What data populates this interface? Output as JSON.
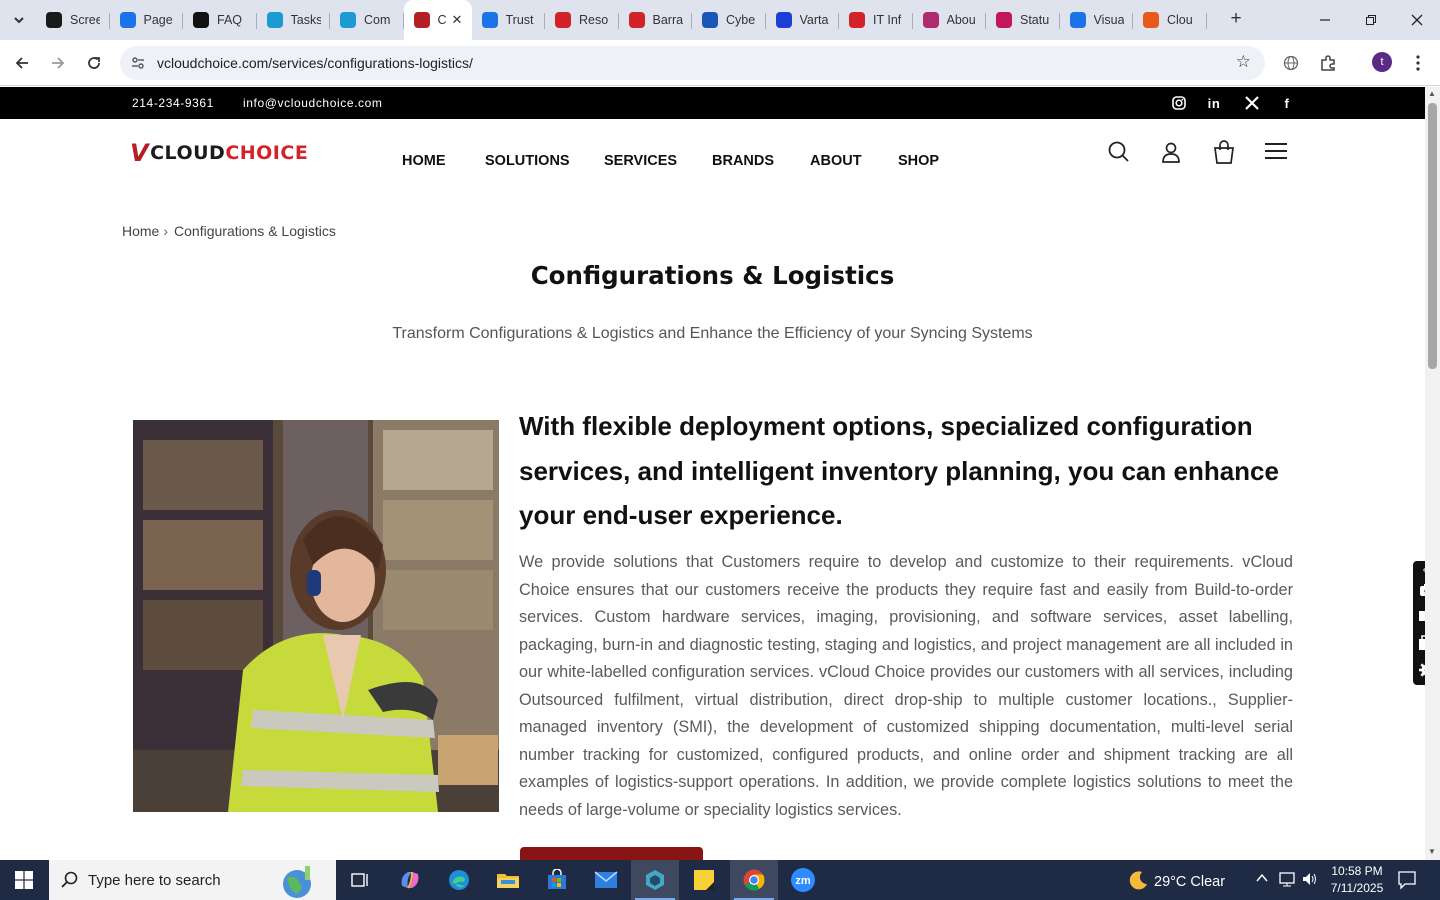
{
  "browser": {
    "tabs": [
      {
        "label": "Scree",
        "icon": "screencastify-icon",
        "color": "#1a1a1a"
      },
      {
        "label": "Page",
        "icon": "pagespeed-icon",
        "color": "#1a73e8"
      },
      {
        "label": "FAQ",
        "icon": "openai-icon",
        "color": "#111111"
      },
      {
        "label": "Tasks",
        "icon": "hexagon-app-icon",
        "color": "#1b9bd1"
      },
      {
        "label": "Com",
        "icon": "hexagon-app-icon",
        "color": "#1b9bd1"
      },
      {
        "label": "C",
        "icon": "vcloudchoice-icon",
        "color": "#b41f24"
      },
      {
        "label": "Trust",
        "icon": "scales-icon",
        "color": "#1a73e8"
      },
      {
        "label": "Reso",
        "icon": "barracuda-icon",
        "color": "#d2232a"
      },
      {
        "label": "Barra",
        "icon": "barracuda-icon",
        "color": "#d2232a"
      },
      {
        "label": "Cybe",
        "icon": "check-icon",
        "color": "#1a56b8"
      },
      {
        "label": "Varta",
        "icon": "x-logo-icon",
        "color": "#1a3fd6"
      },
      {
        "label": "IT Inf",
        "icon": "barracuda-icon",
        "color": "#d2232a"
      },
      {
        "label": "Abou",
        "icon": "flower-icon",
        "color": "#b02a6e"
      },
      {
        "label": "Statu",
        "icon": "pin-icon",
        "color": "#c2185b"
      },
      {
        "label": "Visua",
        "icon": "pulse-icon",
        "color": "#1a73e8"
      },
      {
        "label": "Clou",
        "icon": "cloud-swoosh-icon",
        "color": "#e85a1a"
      }
    ],
    "active_tab_index": 5,
    "new_tab_label": "+",
    "url": "vcloudchoice.com/services/configurations-logistics/",
    "profile_initial": "t"
  },
  "site": {
    "topbar": {
      "phone": "214-234-9361",
      "email": "info@vcloudchoice.com",
      "social": [
        "instagram-icon",
        "linkedin-icon",
        "x-icon",
        "facebook-icon"
      ]
    },
    "logo": {
      "v": "V",
      "cloud": "CLOUD",
      "choice": "CHOICE"
    },
    "nav": [
      "HOME",
      "SOLUTIONS",
      "SERVICES",
      "BRANDS",
      "ABOUT",
      "SHOP"
    ],
    "breadcrumb": {
      "home": "Home",
      "sep": "›",
      "current": "Configurations & Logistics"
    },
    "page_title": "Configurations & Logistics",
    "subtitle": "Transform Configurations & Logistics and Enhance the Efficiency of your Syncing Systems",
    "section": {
      "heading": "With flexible deployment options, specialized configuration services, and intelligent inventory planning, you can enhance your end-user experience.",
      "body": "We provide solutions that Customers require to develop and customize to their requirements. vCloud Choice ensures that our customers receive the products they require fast and easily from Build-to-order services. Custom hardware services, imaging, provisioning, and software services, asset labelling, packaging, burn-in and diagnostic testing, staging and logistics, and project management are all included in our white-labelled configuration services. vCloud Choice provides our customers with all services, including Outsourced fulfilment, virtual distribution, direct drop-ship to multiple customer locations., Supplier-managed inventory (SMI), the development of customized shipping documentation, multi-level serial number tracking for customized, configured products, and online order and shipment tracking are all examples of logistics-support operations. In addition, we provide complete logistics solutions to meet the needs of large-volume or speciality logistics services."
    },
    "colors": {
      "brand_red": "#b41f24",
      "cta": "#8a1414"
    }
  },
  "taskbar": {
    "search_placeholder": "Type here to search",
    "weather": "29°C  Clear",
    "time": "10:58 PM",
    "date": "7/11/2025"
  }
}
